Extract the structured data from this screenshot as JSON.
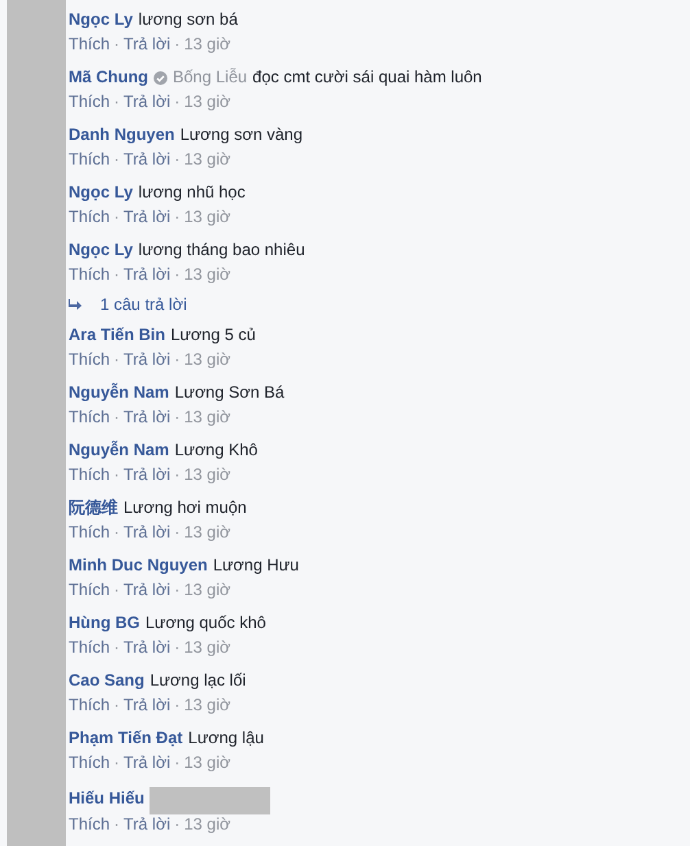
{
  "items": [
    {
      "kind": "comment",
      "author": "Ngọc Ly",
      "text": "lương sơn bá",
      "actions": [
        "Thích",
        "Trả lời"
      ],
      "separator": "·",
      "time": "13 giờ"
    },
    {
      "kind": "comment",
      "author": "Mã Chung",
      "verified": true,
      "mention": "Bống Liễu",
      "text": "đọc cmt cười sái quai hàm luôn",
      "actions": [
        "Thích",
        "Trả lời"
      ],
      "separator": "·",
      "time": "13 giờ"
    },
    {
      "kind": "comment",
      "author": "Danh Nguyen",
      "text": "Lương sơn vàng",
      "actions": [
        "Thích",
        "Trả lời"
      ],
      "separator": "·",
      "time": "13 giờ"
    },
    {
      "kind": "comment",
      "author": "Ngọc Ly",
      "text": "lương nhũ học",
      "actions": [
        "Thích",
        "Trả lời"
      ],
      "separator": "·",
      "time": "13 giờ"
    },
    {
      "kind": "comment",
      "author": "Ngọc Ly",
      "text": "lương tháng bao nhiêu",
      "actions": [
        "Thích",
        "Trả lời"
      ],
      "separator": "·",
      "time": "13 giờ"
    },
    {
      "kind": "replies",
      "label": "1 câu trả lời"
    },
    {
      "kind": "comment",
      "author": "Ara Tiến Bin",
      "text": "Lương 5 củ",
      "actions": [
        "Thích",
        "Trả lời"
      ],
      "separator": "·",
      "time": "13 giờ"
    },
    {
      "kind": "comment",
      "author": "Nguyễn Nam",
      "text": "Lương Sơn Bá",
      "actions": [
        "Thích",
        "Trả lời"
      ],
      "separator": "·",
      "time": "13 giờ"
    },
    {
      "kind": "comment",
      "author": "Nguyễn Nam",
      "text": "Lương Khô",
      "actions": [
        "Thích",
        "Trả lời"
      ],
      "separator": "·",
      "time": "13 giờ"
    },
    {
      "kind": "comment",
      "author": "阮德维",
      "text": "Lương hơi muộn",
      "actions": [
        "Thích",
        "Trả lời"
      ],
      "separator": "·",
      "time": "13 giờ"
    },
    {
      "kind": "comment",
      "author": "Minh Duc Nguyen",
      "text": "Lương Hưu",
      "actions": [
        "Thích",
        "Trả lời"
      ],
      "separator": "·",
      "time": "13 giờ"
    },
    {
      "kind": "comment",
      "author": "Hùng BG",
      "text": "Lương quốc khô",
      "actions": [
        "Thích",
        "Trả lời"
      ],
      "separator": "·",
      "time": "13 giờ"
    },
    {
      "kind": "comment",
      "author": "Cao Sang",
      "text": "Lương lạc lối",
      "actions": [
        "Thích",
        "Trả lời"
      ],
      "separator": "·",
      "time": "13 giờ"
    },
    {
      "kind": "comment",
      "author": "Phạm Tiến Đạt",
      "text": "Lương lậu",
      "actions": [
        "Thích",
        "Trả lời"
      ],
      "separator": "·",
      "time": "13 giờ"
    },
    {
      "kind": "comment",
      "author": "Hiếu Hiếu",
      "redacted": true,
      "actions": [
        "Thích",
        "Trả lời"
      ],
      "separator": "·",
      "time": "13 giờ"
    }
  ]
}
